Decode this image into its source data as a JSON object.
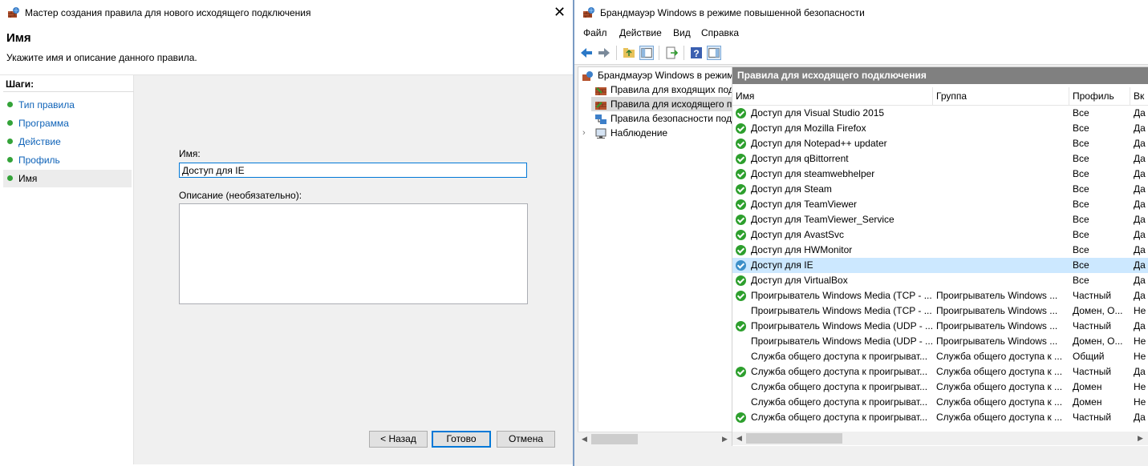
{
  "wizard": {
    "title": "Мастер создания правила для нового исходящего подключения",
    "close_glyph": "✕",
    "header_title": "Имя",
    "header_subtitle": "Укажите имя и описание данного правила.",
    "steps_label": "Шаги:",
    "steps": [
      {
        "label": "Тип правила"
      },
      {
        "label": "Программа"
      },
      {
        "label": "Действие"
      },
      {
        "label": "Профиль"
      },
      {
        "label": "Имя"
      }
    ],
    "name_label": "Имя:",
    "name_value": "Доступ для IE",
    "description_label": "Описание (необязательно):",
    "description_value": "",
    "back_button": "< Назад",
    "finish_button": "Готово",
    "cancel_button": "Отмена"
  },
  "mmc": {
    "title": "Брандмауэр Windows в режиме повышенной безопасности",
    "menu": [
      "Файл",
      "Действие",
      "Вид",
      "Справка"
    ],
    "tree": [
      {
        "label": "Брандмауэр Windows в режим"
      },
      {
        "label": "Правила для входящих под"
      },
      {
        "label": "Правила для исходящего п"
      },
      {
        "label": "Правила безопасности под"
      },
      {
        "label": "Наблюдение"
      }
    ],
    "pane_title": "Правила для исходящего подключения",
    "columns": [
      "Имя",
      "Группа",
      "Профиль",
      "Вк"
    ],
    "rows": [
      {
        "name": "Доступ для Visual Studio 2015",
        "group": "",
        "profile": "Все",
        "enabled": "Да",
        "check": true
      },
      {
        "name": "Доступ для Mozilla Firefox",
        "group": "",
        "profile": "Все",
        "enabled": "Да",
        "check": true
      },
      {
        "name": "Доступ для Notepad++ updater",
        "group": "",
        "profile": "Все",
        "enabled": "Да",
        "check": true
      },
      {
        "name": "Доступ для qBittorrent",
        "group": "",
        "profile": "Все",
        "enabled": "Да",
        "check": true
      },
      {
        "name": "Доступ для steamwebhelper",
        "group": "",
        "profile": "Все",
        "enabled": "Да",
        "check": true
      },
      {
        "name": "Доступ для Steam",
        "group": "",
        "profile": "Все",
        "enabled": "Да",
        "check": true
      },
      {
        "name": "Доступ для TeamViewer",
        "group": "",
        "profile": "Все",
        "enabled": "Да",
        "check": true
      },
      {
        "name": "Доступ для TeamViewer_Service",
        "group": "",
        "profile": "Все",
        "enabled": "Да",
        "check": true
      },
      {
        "name": "Доступ для AvastSvc",
        "group": "",
        "profile": "Все",
        "enabled": "Да",
        "check": true
      },
      {
        "name": "Доступ для HWMonitor",
        "group": "",
        "profile": "Все",
        "enabled": "Да",
        "check": true
      },
      {
        "name": "Доступ для IE",
        "group": "",
        "profile": "Все",
        "enabled": "Да",
        "check": true,
        "selected": true
      },
      {
        "name": "Доступ для VirtualBox",
        "group": "",
        "profile": "Все",
        "enabled": "Да",
        "check": true
      },
      {
        "name": "Проигрыватель Windows Media (TCP - ...",
        "group": "Проигрыватель Windows ...",
        "profile": "Частный",
        "enabled": "Да",
        "check": true
      },
      {
        "name": "Проигрыватель Windows Media (TCP - ...",
        "group": "Проигрыватель Windows ...",
        "profile": "Домен, О...",
        "enabled": "Не",
        "check": false
      },
      {
        "name": "Проигрыватель Windows Media (UDP - ...",
        "group": "Проигрыватель Windows ...",
        "profile": "Частный",
        "enabled": "Да",
        "check": true
      },
      {
        "name": "Проигрыватель Windows Media (UDP - ...",
        "group": "Проигрыватель Windows ...",
        "profile": "Домен, О...",
        "enabled": "Не",
        "check": false
      },
      {
        "name": "Служба общего доступа к проигрыват...",
        "group": "Служба общего доступа к ...",
        "profile": "Общий",
        "enabled": "Не",
        "check": false
      },
      {
        "name": "Служба общего доступа к проигрыват...",
        "group": "Служба общего доступа к ...",
        "profile": "Частный",
        "enabled": "Да",
        "check": true
      },
      {
        "name": "Служба общего доступа к проигрыват...",
        "group": "Служба общего доступа к ...",
        "profile": "Домен",
        "enabled": "Не",
        "check": false
      },
      {
        "name": "Служба общего доступа к проигрыват...",
        "group": "Служба общего доступа к ...",
        "profile": "Домен",
        "enabled": "Не",
        "check": false
      },
      {
        "name": "Служба общего доступа к проигрыват...",
        "group": "Служба общего доступа к ...",
        "profile": "Частный",
        "enabled": "Да",
        "check": true
      }
    ]
  },
  "colors": {
    "accent": "#0078d7",
    "link": "#0f63b8",
    "step_dot": "#34a339",
    "pane_header": "#808080",
    "row_selected": "#cce8ff"
  }
}
